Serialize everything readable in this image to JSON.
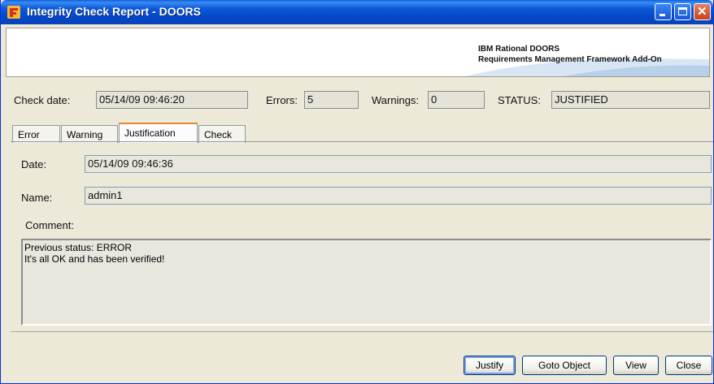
{
  "window": {
    "title": "Integrity Check Report - DOORS"
  },
  "banner": {
    "line1": "IBM Rational DOORS",
    "line2": "Requirements Management Framework Add-On"
  },
  "summary": {
    "check_date_label": "Check date:",
    "check_date_value": "05/14/09 09:46:20",
    "errors_label": "Errors:",
    "errors_value": "5",
    "warnings_label": "Warnings:",
    "warnings_value": "0",
    "status_label": "STATUS:",
    "status_value": "JUSTIFIED"
  },
  "tabs": [
    {
      "label": "Error",
      "active": false
    },
    {
      "label": "Warning",
      "active": false
    },
    {
      "label": "Justification",
      "active": true
    },
    {
      "label": "Check",
      "active": false
    }
  ],
  "justification": {
    "date_label": "Date:",
    "date_value": "05/14/09 09:46:36",
    "name_label": "Name:",
    "name_value": "admin1",
    "comment_label": "Comment:",
    "comment_lines": [
      "Previous status: ERROR",
      "It's all OK and has been verified!"
    ]
  },
  "buttons": {
    "justify": "Justify",
    "goto_object": "Goto Object",
    "view": "View",
    "close": "Close"
  }
}
